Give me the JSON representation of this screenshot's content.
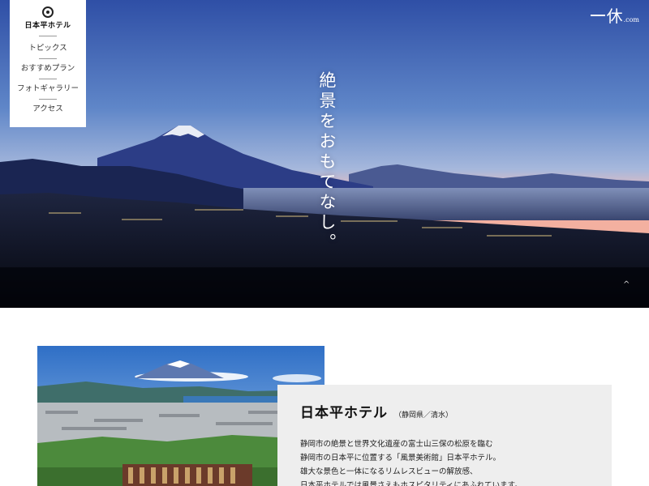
{
  "nav": {
    "logo_text": "日本平ホテル",
    "items": [
      {
        "label": "トピックス"
      },
      {
        "label": "おすすめプラン"
      },
      {
        "label": "フォトギャラリー"
      },
      {
        "label": "アクセス"
      }
    ]
  },
  "brand": {
    "kanji": "休",
    "suffix": ".com"
  },
  "hero": {
    "tagline": "絶景をおもてなし。",
    "scroll_icon": "^"
  },
  "hotel": {
    "name": "日本平ホテル",
    "region": "（静岡県／清水）",
    "description": [
      "静岡市の絶景と世界文化遺産の富士山三保の松原を臨む",
      "静岡市の日本平に位置する「風景美術館」日本平ホテル。",
      "雄大な景色と一体になるリムレスビューの解放感、",
      "日本平ホテルでは風景さえもホスピタリティにあふれています。"
    ]
  },
  "colors": {
    "sky_top": "#2a4fa8",
    "sky_horizon": "#f2b4a8",
    "card_bg": "#eeeeee"
  }
}
